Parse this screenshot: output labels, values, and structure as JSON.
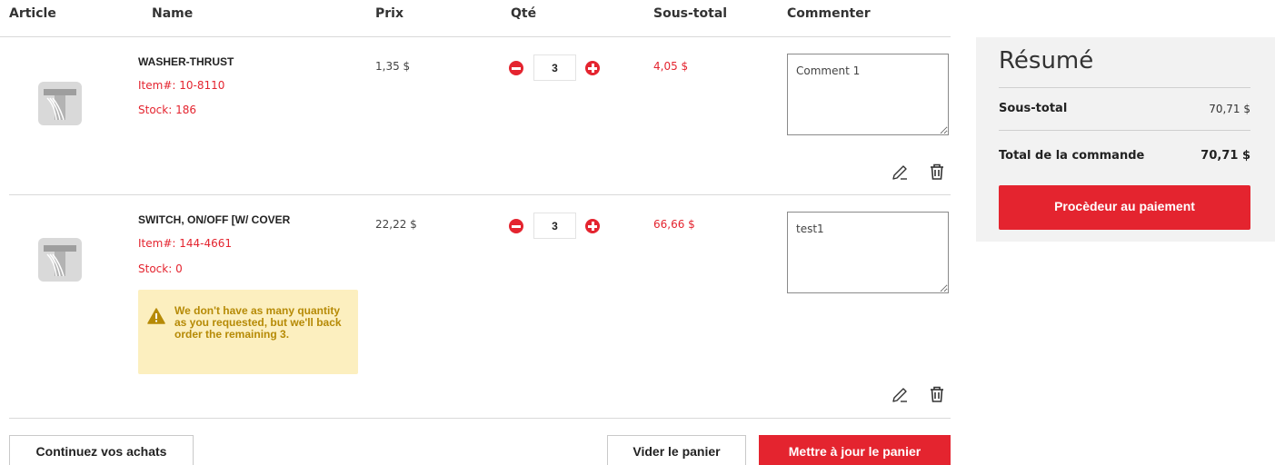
{
  "table": {
    "headers": {
      "article": "Article",
      "name": "Name",
      "price": "Prix",
      "qty": "Qté",
      "subtotal": "Sous-total",
      "comment": "Commenter"
    }
  },
  "items": [
    {
      "name": "WASHER-THRUST",
      "item_no": "Item#: 10-8110",
      "stock": "Stock: 186",
      "price": "1,35 $",
      "qty": "3",
      "subtotal": "4,05 $",
      "comment": "Comment 1",
      "icons": {
        "thumbnail": "product-logo-icon",
        "edit": "pencil-icon",
        "delete": "trash-icon"
      }
    },
    {
      "name": "SWITCH, ON/OFF [W/ COVER",
      "item_no": "Item#: 144-4661",
      "stock": "Stock: 0",
      "price": "22,22 $",
      "qty": "3",
      "subtotal": "66,66 $",
      "comment": "test1",
      "warning": "We don't have as many quantity as you requested, but we'll back order the remaining 3.",
      "icons": {
        "thumbnail": "product-logo-icon",
        "edit": "pencil-icon",
        "delete": "trash-icon",
        "warning": "warning-icon"
      }
    }
  ],
  "actions": {
    "continue": "Continuez vos achats",
    "empty": "Vider le panier",
    "update": "Mettre à jour le panier"
  },
  "summary": {
    "title": "Résumé",
    "subtotal_label": "Sous-total",
    "subtotal_value": "70,71 $",
    "total_label": "Total de la commande",
    "total_value": "70,71 $",
    "checkout": "Procèdeur au paiement"
  },
  "colors": {
    "accent": "#e4242f",
    "warning_bg": "#fcefbf",
    "warning_text": "#b68a06",
    "summary_bg": "#f2f2f2"
  }
}
